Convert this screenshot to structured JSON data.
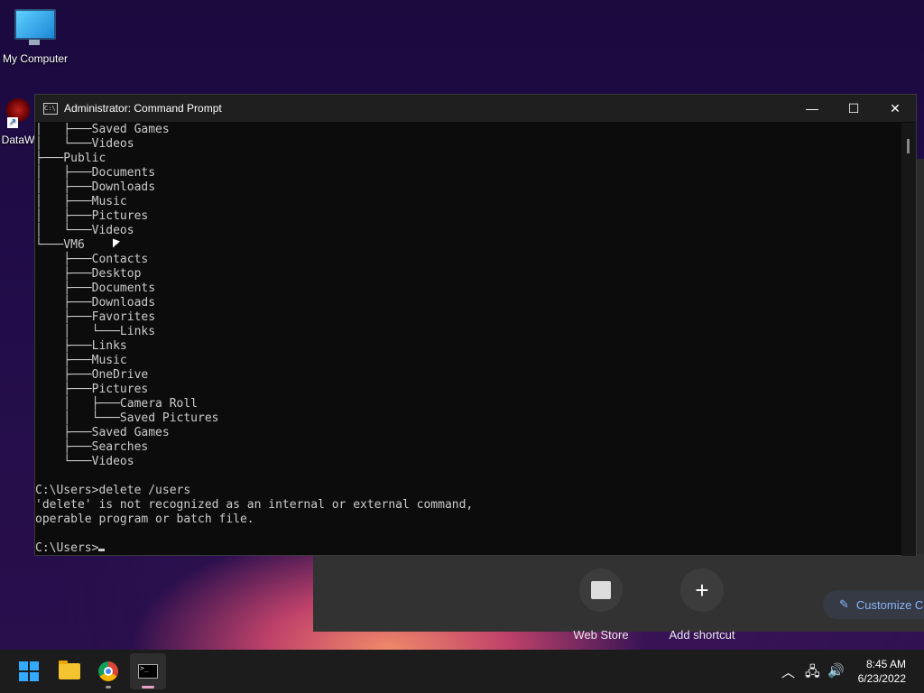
{
  "desktop": {
    "icons": [
      {
        "label": "My Computer"
      },
      {
        "label": "DataW"
      }
    ]
  },
  "browser_background": {
    "shortcuts": [
      {
        "label": "Web Store",
        "icon": "web-store-icon"
      },
      {
        "label": "Add shortcut",
        "icon": "plus-icon",
        "symbol": "+"
      }
    ],
    "customize_label": "Customize C"
  },
  "window": {
    "title": "Administrator: Command Prompt",
    "icon": "cmd-icon",
    "minimize_symbol": "—",
    "maximize_symbol": "☐",
    "close_symbol": "✕",
    "console_lines": [
      "│   ├───Saved Games",
      "│   └───Videos",
      "├───Public",
      "│   ├───Documents",
      "│   ├───Downloads",
      "│   ├───Music",
      "│   ├───Pictures",
      "│   └───Videos",
      "└───VM6",
      "    ├───Contacts",
      "    ├───Desktop",
      "    ├───Documents",
      "    ├───Downloads",
      "    ├───Favorites",
      "    │   └───Links",
      "    ├───Links",
      "    ├───Music",
      "    ├───OneDrive",
      "    ├───Pictures",
      "    │   ├───Camera Roll",
      "    │   └───Saved Pictures",
      "    ├───Saved Games",
      "    ├───Searches",
      "    └───Videos",
      "",
      "C:\\Users>delete /users",
      "'delete' is not recognized as an internal or external command,",
      "operable program or batch file.",
      ""
    ],
    "prompt": "C:\\Users>"
  },
  "taskbar": {
    "apps": [
      {
        "name": "Start",
        "icon": "windows-start-icon"
      },
      {
        "name": "File Explorer",
        "icon": "folder-icon"
      },
      {
        "name": "Google Chrome",
        "icon": "chrome-icon"
      },
      {
        "name": "Command Prompt",
        "icon": "terminal-icon",
        "active": true
      }
    ],
    "tray": {
      "chevron": "︿",
      "network": "🖧",
      "volume": "🔊"
    },
    "time": "8:45 AM",
    "date": "6/23/2022"
  },
  "colors": {
    "console_bg": "#0c0c0c",
    "console_text": "#cccccc",
    "taskbar_bg": "#1c1c1c",
    "accent_blue": "#33aaff"
  }
}
